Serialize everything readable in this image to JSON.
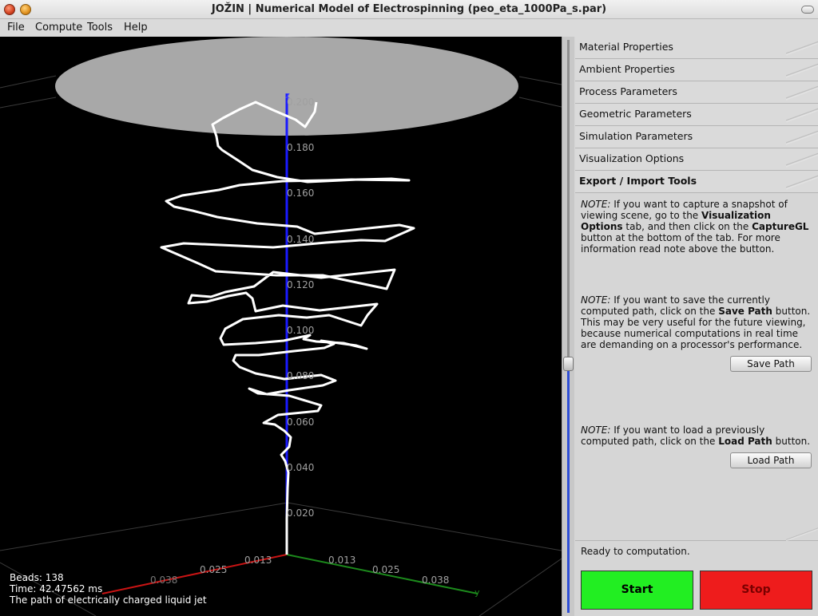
{
  "window": {
    "title": "JOŽIN | Numerical Model of Electrospinning (peo_eta_1000Pa_s.par)"
  },
  "menu": [
    "File",
    "Compute",
    "Tools",
    "Help"
  ],
  "viewport": {
    "z_axis_label": "z",
    "y_axis_label": "y",
    "z_ticks": [
      "0.200",
      "0.180",
      "0.160",
      "0.140",
      "0.120",
      "0.100",
      "0.080",
      "0.060",
      "0.040",
      "0.020"
    ],
    "left_ticks": [
      "0.013",
      "0.025",
      "0.038"
    ],
    "right_ticks": [
      "0.013",
      "0.025",
      "0.038"
    ],
    "info": {
      "beads": "Beads: 138",
      "time": "Time: 42.47562 ms",
      "caption": "The path of electrically charged liquid jet"
    },
    "colors": {
      "z_axis": "#1a1aff",
      "x_axis": "#c81414",
      "y_axis": "#1c8a1c",
      "jet": "#ffffff",
      "collector": "#a8a8a8"
    }
  },
  "tabs": [
    {
      "label": "Material Properties",
      "active": false
    },
    {
      "label": "Ambient Properties",
      "active": false
    },
    {
      "label": "Process Parameters",
      "active": false
    },
    {
      "label": "Geometric Parameters",
      "active": false
    },
    {
      "label": "Simulation Parameters",
      "active": false
    },
    {
      "label": "Visualization Options",
      "active": false
    },
    {
      "label": "Export / Import Tools",
      "active": true
    }
  ],
  "notes": {
    "capture": "If you want to capture a snapshot of viewing scene, go to the",
    "capture_tab": "Visualization Options",
    "capture_mid": "tab, and then click on the",
    "capture_btn": "CaptureGL",
    "capture_end": "button at the bottom of the tab. For more information read note above the button.",
    "save": "If you want to save the currently computed path, click on the",
    "save_btn": "Save Path",
    "save_end": "button. This may be very useful for the future viewing, because numerical computations in real time are demanding on a processor's performance.",
    "load": "If you want to load a previously computed path, click on the",
    "load_btn": "Load Path",
    "load_end": "button.",
    "prefix": "NOTE:"
  },
  "buttons": {
    "save": "Save Path",
    "load": "Load Path",
    "start": "Start",
    "stop": "Stop"
  },
  "status": "Ready to computation."
}
